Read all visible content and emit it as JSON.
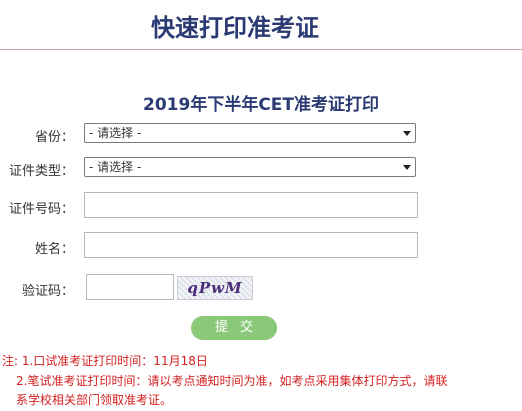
{
  "header": {
    "title": "快速打印准考证"
  },
  "form": {
    "heading": "2019年下半年CET准考证打印",
    "province_label": "省份：",
    "province_value": "- 请选择 -",
    "idtype_label": "证件类型：",
    "idtype_value": "- 请选择 -",
    "idnumber_label": "证件号码：",
    "idnumber_value": "",
    "name_label": "姓名：",
    "name_value": "",
    "captcha_label": "验证码：",
    "captcha_value": "",
    "captcha_image_text": "qPwM",
    "submit_label": "提交"
  },
  "notes": {
    "line1": "注: 1.口试准考证打印时间：11月18日",
    "line2": "2.笔试准考证打印时间：请以考点通知时间为准，如考点采用集体打印方式，请联",
    "line3": "系学校相关部门领取准考证。"
  },
  "colors": {
    "title": "#2b3a73",
    "submit_bg": "#8cc879",
    "note_text": "#d42020"
  }
}
